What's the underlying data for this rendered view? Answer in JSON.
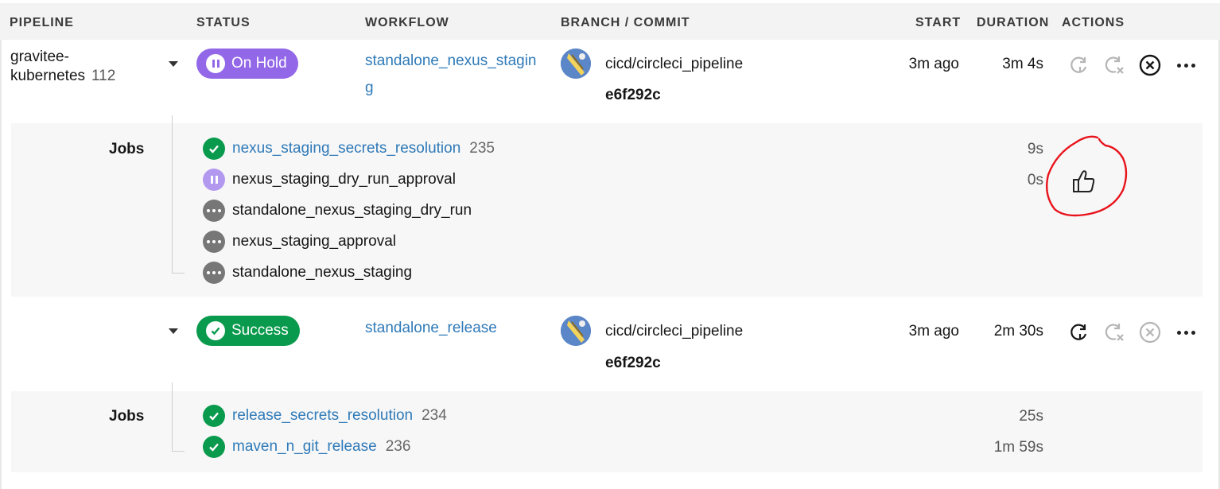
{
  "header": {
    "pipeline": "PIPELINE",
    "status": "STATUS",
    "workflow": "WORKFLOW",
    "branch_commit": "BRANCH / COMMIT",
    "start": "START",
    "duration": "DURATION",
    "actions": "ACTIONS"
  },
  "pipeline": {
    "name_line1": "gravitee-",
    "name_line2": "kubernetes",
    "number": "112"
  },
  "workflows": [
    {
      "status": "On Hold",
      "status_color": "#9368e8",
      "name_line1": "standalone_nexus_stagin",
      "name_line2": "g",
      "branch": "cicd/circleci_pipeline",
      "commit": "e6f292c",
      "start": "3m ago",
      "duration": "3m 4s",
      "jobs_label": "Jobs",
      "jobs": [
        {
          "name": "nexus_staging_secrets_resolution",
          "number": "235",
          "state": "success",
          "duration": "9s"
        },
        {
          "name": "nexus_staging_dry_run_approval",
          "number": "",
          "state": "on-hold",
          "duration": "0s"
        },
        {
          "name": "standalone_nexus_staging_dry_run",
          "number": "",
          "state": "pending",
          "duration": ""
        },
        {
          "name": "nexus_staging_approval",
          "number": "",
          "state": "pending",
          "duration": ""
        },
        {
          "name": "standalone_nexus_staging",
          "number": "",
          "state": "pending",
          "duration": ""
        }
      ]
    },
    {
      "status": "Success",
      "status_color": "#0a9a4d",
      "name_line1": "standalone_release",
      "branch": "cicd/circleci_pipeline",
      "commit": "e6f292c",
      "start": "3m ago",
      "duration": "2m 30s",
      "jobs_label": "Jobs",
      "jobs": [
        {
          "name": "release_secrets_resolution",
          "number": "234",
          "state": "success",
          "duration": "25s"
        },
        {
          "name": "maven_n_git_release",
          "number": "236",
          "state": "success",
          "duration": "1m 59s"
        }
      ]
    }
  ],
  "icons": {
    "rerun": "rerun-icon",
    "rerun_failed": "rerun-failed-icon",
    "cancel": "cancel-icon",
    "more": "more-icon",
    "approve": "thumbs-up-icon"
  },
  "annotation_color": "#e8131b"
}
